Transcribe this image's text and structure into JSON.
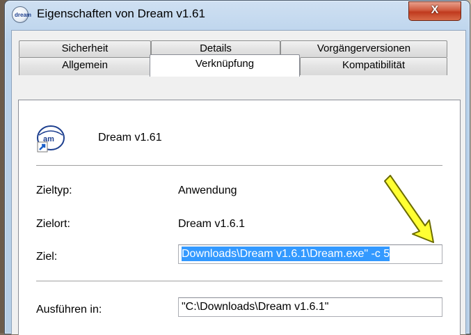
{
  "window": {
    "title": "Eigenschaften von Dream v1.61",
    "close_label": "X"
  },
  "tabs_back": [
    "Sicherheit",
    "Details",
    "Vorgängerversionen"
  ],
  "tabs_front": [
    "Allgemein",
    "Verknüpfung",
    "Kompatibilität"
  ],
  "active_tab": "Verknüpfung",
  "shortcut": {
    "icon_text": "dream",
    "name": "Dream v1.61",
    "zieltyp_label": "Zieltyp:",
    "zieltyp_value": "Anwendung",
    "zielort_label": "Zielort:",
    "zielort_value": "Dream v1.6.1",
    "ziel_label": "Ziel:",
    "ziel_value": "Downloads\\Dream v1.6.1\\Dream.exe\" -c 5",
    "ausfuehren_label": "Ausführen in:",
    "ausfuehren_value": "\"C:\\Downloads\\Dream v1.6.1\""
  },
  "colors": {
    "selection": "#3399ff",
    "close_button": "#c03a1e",
    "annotation_arrow": "#ffff00"
  }
}
